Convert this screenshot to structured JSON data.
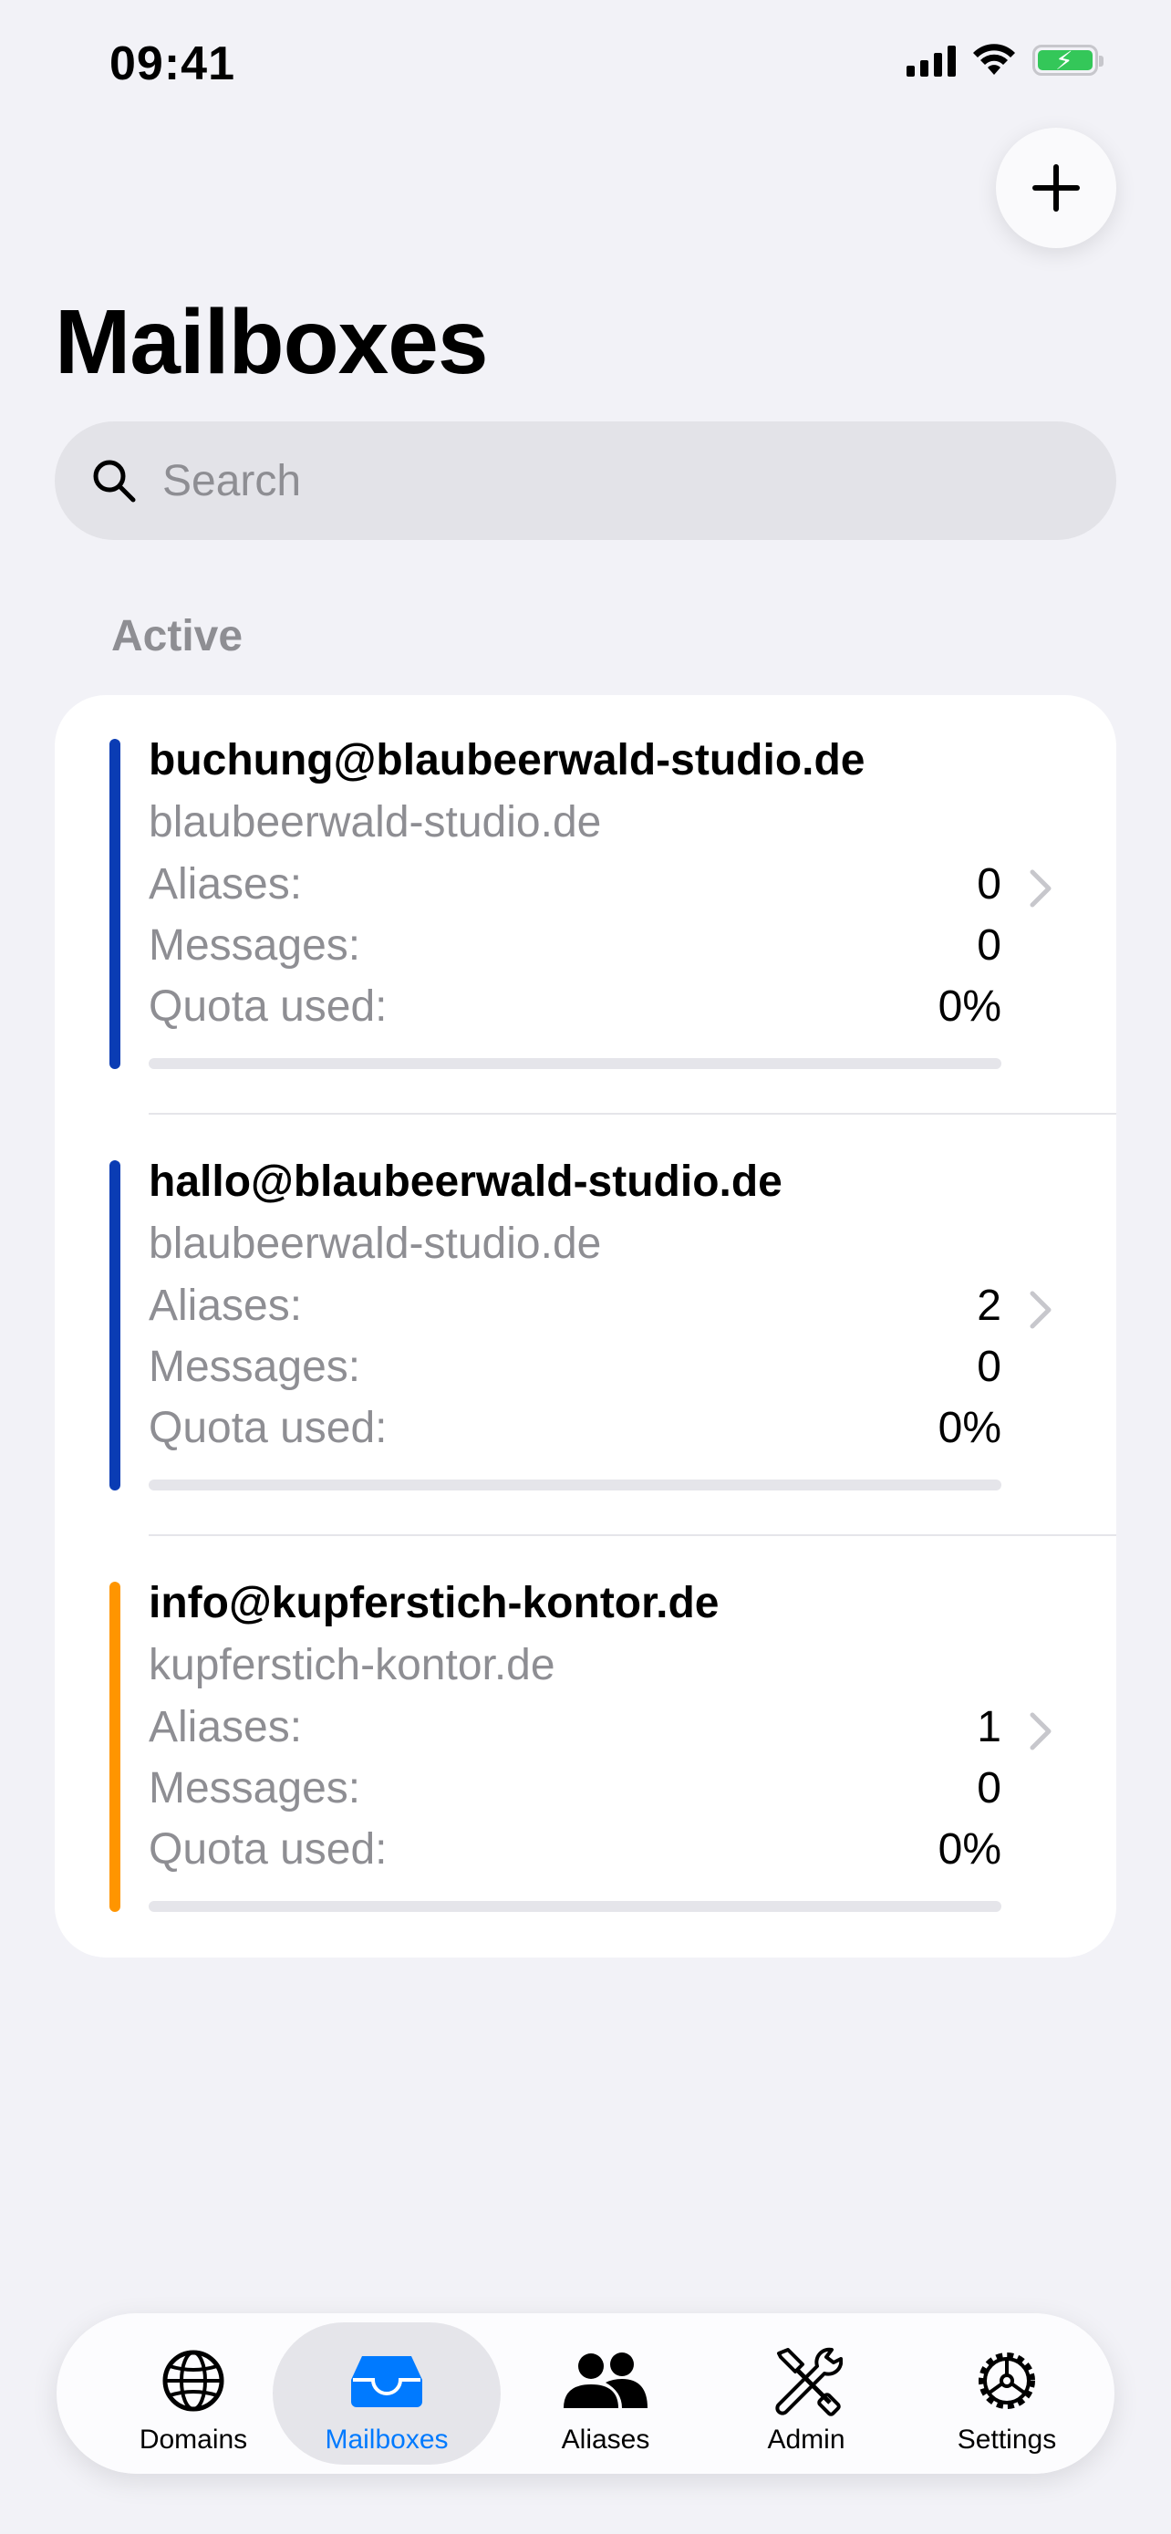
{
  "status_bar": {
    "time": "09:41"
  },
  "header": {
    "title": "Mailboxes",
    "add_button": "plus-icon"
  },
  "search": {
    "placeholder": "Search"
  },
  "section": {
    "title": "Active"
  },
  "mailboxes": [
    {
      "email": "buchung@blaubeerwald-studio.de",
      "domain": "blaubeerwald-studio.de",
      "aliases_label": "Aliases:",
      "aliases": "0",
      "messages_label": "Messages:",
      "messages": "0",
      "quota_label": "Quota used:",
      "quota": "0%",
      "quota_fraction": 0,
      "accent": "#0a3cb4"
    },
    {
      "email": "hallo@blaubeerwald-studio.de",
      "domain": "blaubeerwald-studio.de",
      "aliases_label": "Aliases:",
      "aliases": "2",
      "messages_label": "Messages:",
      "messages": "0",
      "quota_label": "Quota used:",
      "quota": "0%",
      "quota_fraction": 0,
      "accent": "#0a3cb4"
    },
    {
      "email": "info@kupferstich-kontor.de",
      "domain": "kupferstich-kontor.de",
      "aliases_label": "Aliases:",
      "aliases": "1",
      "messages_label": "Messages:",
      "messages": "0",
      "quota_label": "Quota used:",
      "quota": "0%",
      "quota_fraction": 0,
      "accent": "#ff9500"
    }
  ],
  "tabbar": {
    "tabs": [
      {
        "label": "Domains",
        "icon": "globe-icon"
      },
      {
        "label": "Mailboxes",
        "icon": "tray-icon",
        "active": true
      },
      {
        "label": "Aliases",
        "icon": "people-icon"
      },
      {
        "label": "Admin",
        "icon": "wrench-screwdriver-icon"
      },
      {
        "label": "Settings",
        "icon": "gear-icon"
      }
    ]
  },
  "colors": {
    "accent": "#007aff",
    "background": "#f2f2f7",
    "secondary_text": "#8e8e93"
  }
}
